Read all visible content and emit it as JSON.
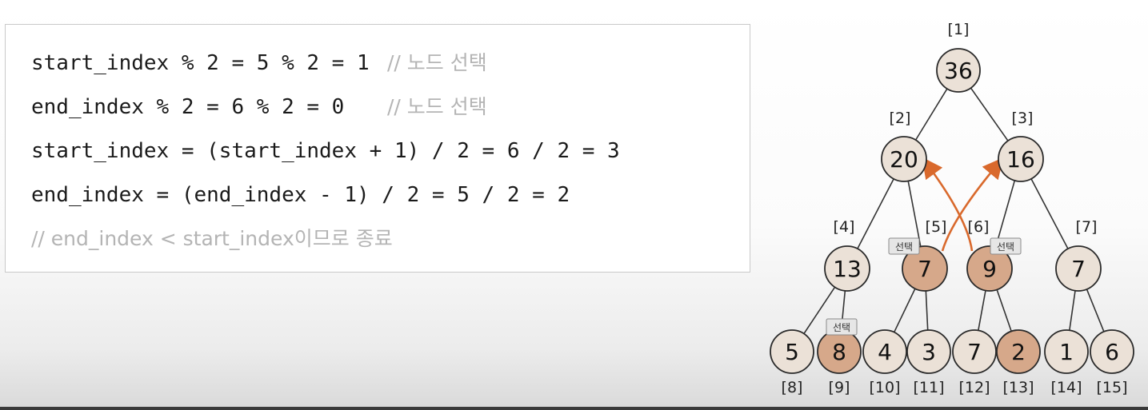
{
  "code": {
    "lines": [
      {
        "code": "start_index % 2 = 5 % 2 = 1",
        "comment": "// 노드 선택"
      },
      {
        "code": "end_index % 2 = 6 % 2 = 0",
        "comment": "// 노드 선택"
      },
      {
        "code": "start_index = (start_index + 1) / 2 = 6 / 2 = 3",
        "comment": ""
      },
      {
        "code": "end_index = (end_index - 1) / 2 = 5 / 2 = 2",
        "comment": ""
      }
    ],
    "note": "// end_index < start_index이므로 종료"
  },
  "tree": {
    "nodes": [
      {
        "index": "[1]",
        "value": "36",
        "selected": false
      },
      {
        "index": "[2]",
        "value": "20",
        "selected": false
      },
      {
        "index": "[3]",
        "value": "16",
        "selected": false
      },
      {
        "index": "[4]",
        "value": "13",
        "selected": false
      },
      {
        "index": "[5]",
        "value": "7",
        "selected": true
      },
      {
        "index": "[6]",
        "value": "9",
        "selected": true
      },
      {
        "index": "[7]",
        "value": "7",
        "selected": false
      },
      {
        "index": "[8]",
        "value": "5",
        "selected": false
      },
      {
        "index": "[9]",
        "value": "8",
        "selected": true
      },
      {
        "index": "[10]",
        "value": "4",
        "selected": false
      },
      {
        "index": "[11]",
        "value": "3",
        "selected": false
      },
      {
        "index": "[12]",
        "value": "7",
        "selected": false
      },
      {
        "index": "[13]",
        "value": "2",
        "selected": true
      },
      {
        "index": "[14]",
        "value": "1",
        "selected": false
      },
      {
        "index": "[15]",
        "value": "6",
        "selected": false
      }
    ],
    "select_badge": "선택",
    "badges_on": [
      5,
      6,
      9
    ],
    "arrows": [
      {
        "from": 5,
        "to": 3
      },
      {
        "from": 6,
        "to": 2
      }
    ],
    "colors": {
      "node_fill": "#ebe1d7",
      "selected_fill": "#d6a88a",
      "edge": "#333333",
      "arrow": "#d9692c",
      "badge_fill": "#e6e6e6"
    }
  }
}
